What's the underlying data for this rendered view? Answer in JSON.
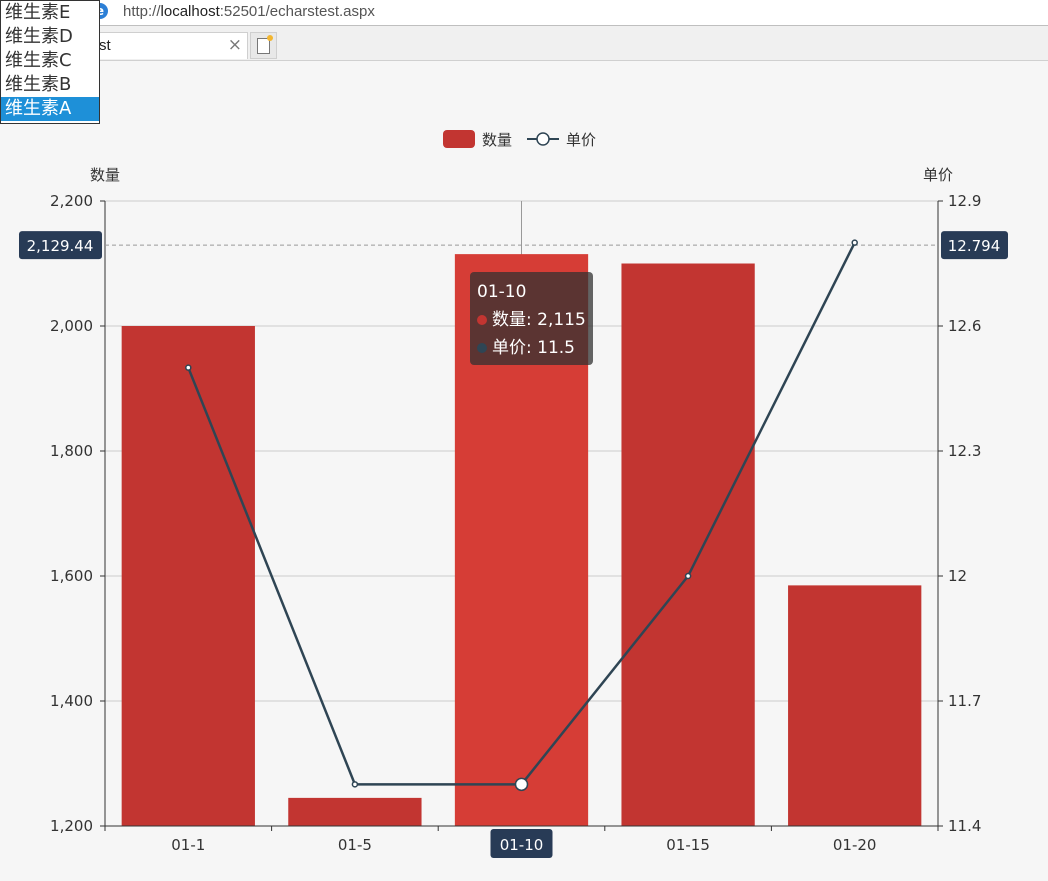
{
  "browser": {
    "url_prefix": "http://",
    "url_host": "localhost",
    "url_rest": ":52501/echarstest.aspx",
    "tab_title": "st",
    "tab_close": "×"
  },
  "dropdown": {
    "options": [
      "维生素E",
      "维生素D",
      "维生素C",
      "维生素B",
      "维生素A"
    ],
    "selected": "维生素A"
  },
  "colors": {
    "bar": "#c23531",
    "bar_highlight": "#d63d36",
    "line": "#2f4554",
    "axis_pointer_label": "#283b56"
  },
  "chart_data": {
    "type": "bar",
    "categories": [
      "01-1",
      "01-5",
      "01-10",
      "01-15",
      "01-20"
    ],
    "series": [
      {
        "name": "数量",
        "type": "bar",
        "yAxis": "left",
        "values": [
          2000,
          1245,
          2115,
          2100,
          1585
        ]
      },
      {
        "name": "单价",
        "type": "line",
        "yAxis": "right",
        "values": [
          12.5,
          11.5,
          11.5,
          12.0,
          12.8
        ]
      }
    ],
    "legend": [
      "数量",
      "单价"
    ],
    "legend_position": "top-center",
    "y_left": {
      "label": "数量",
      "min": 1200,
      "max": 2200,
      "ticks": [
        1200,
        1400,
        1600,
        1800,
        2000,
        2200
      ],
      "tick_labels": [
        "1,200",
        "1,400",
        "1,600",
        "1,800",
        "2,000",
        "2,200"
      ]
    },
    "y_right": {
      "label": "单价",
      "min": 11.4,
      "max": 12.9,
      "ticks": [
        11.4,
        11.7,
        12.0,
        12.3,
        12.6,
        12.9
      ],
      "tick_labels": [
        "11.4",
        "11.7",
        "12",
        "12.3",
        "12.6",
        "12.9"
      ]
    },
    "grid": true,
    "axis_pointer": {
      "category": "01-10",
      "left_value": 2129.44,
      "left_label": "2,129.44",
      "right_label": "12.794"
    },
    "tooltip": {
      "title": "01-10",
      "line1": "数量: 2,115",
      "line2": "单价: 11.5"
    }
  }
}
